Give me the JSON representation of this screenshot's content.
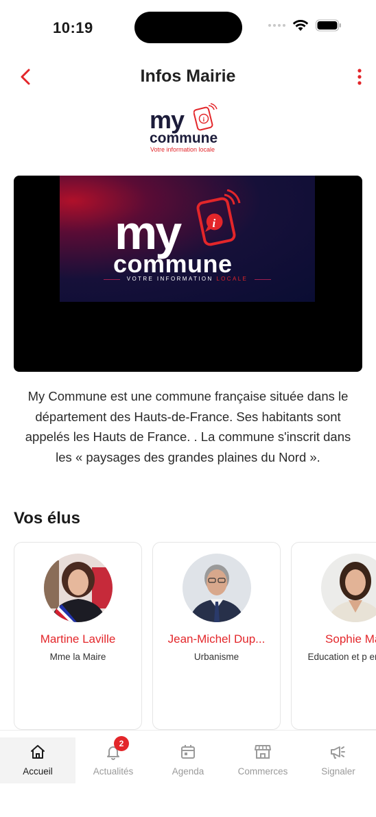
{
  "status_bar": {
    "time": "10:19"
  },
  "header": {
    "title": "Infos Mairie"
  },
  "logo": {
    "word1": "my",
    "word2": "commune",
    "tagline": "Votre information locale"
  },
  "banner": {
    "word1": "my",
    "word2": "commune",
    "tagline_main": "VOTRE INFORMATION ",
    "tagline_accent": "LOCALE"
  },
  "description": "My Commune est une commune française située dans le département des Hauts-de-France. Ses habitants sont appelés les Hauts de France. . La commune s'inscrit dans les « paysages des grandes plaines du Nord ».",
  "elus": {
    "title": "Vos élus",
    "items": [
      {
        "name": "Martine Laville",
        "role": "Mme la Maire"
      },
      {
        "name": "Jean-Michel Dup...",
        "role": "Urbanisme"
      },
      {
        "name": "Sophie Mar",
        "role": "Education et p enfance"
      }
    ]
  },
  "tabs": [
    {
      "label": "Accueil",
      "icon": "home-icon",
      "active": true
    },
    {
      "label": "Actualités",
      "icon": "bell-icon",
      "badge": "2"
    },
    {
      "label": "Agenda",
      "icon": "calendar-icon"
    },
    {
      "label": "Commerces",
      "icon": "store-icon"
    },
    {
      "label": "Signaler",
      "icon": "megaphone-icon"
    }
  ],
  "colors": {
    "accent": "#e3262a",
    "text": "#1a1a1a",
    "muted": "#9a9a9a"
  }
}
